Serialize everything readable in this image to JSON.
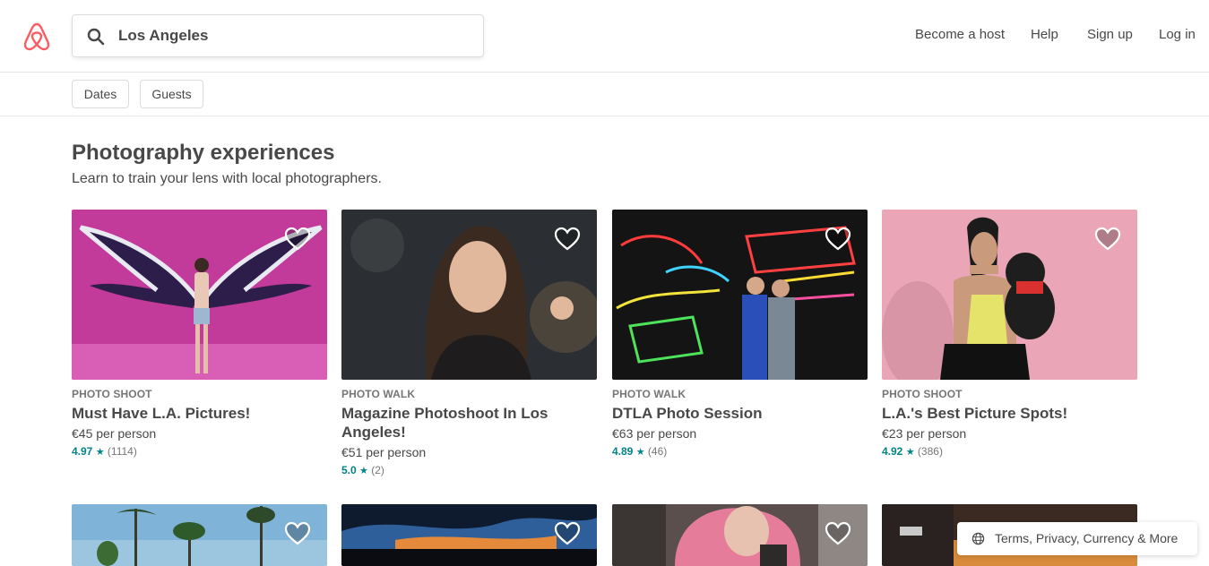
{
  "header": {
    "logo_icon": "airbnb-logo-icon",
    "brand_color": "#FF5A5F",
    "search": {
      "value": "Los Angeles",
      "icon": "search-icon"
    },
    "nav": [
      "Become a host",
      "Help",
      "Sign up",
      "Log in"
    ]
  },
  "filters": [
    "Dates",
    "Guests"
  ],
  "section": {
    "title": "Photography experiences",
    "subtitle": "Learn to train your lens with local photographers."
  },
  "cards": [
    {
      "category": "PHOTO SHOOT",
      "name": "Must Have L.A. Pictures!",
      "price": "€45 per person",
      "rating": "4.97",
      "reviews": "(1114)"
    },
    {
      "category": "PHOTO WALK",
      "name": "Magazine Photoshoot In Los Angeles!",
      "price": "€51 per person",
      "rating": "5.0",
      "reviews": "(2)"
    },
    {
      "category": "PHOTO WALK",
      "name": "DTLA Photo Session",
      "price": "€63 per person",
      "rating": "4.89",
      "reviews": "(46)"
    },
    {
      "category": "PHOTO SHOOT",
      "name": "L.A.'s Best Picture Spots!",
      "price": "€23 per person",
      "rating": "4.92",
      "reviews": "(386)"
    }
  ],
  "accent_rating_color": "#008489",
  "footer": {
    "label": "Terms, Privacy, Currency & More",
    "icon": "globe-icon"
  }
}
